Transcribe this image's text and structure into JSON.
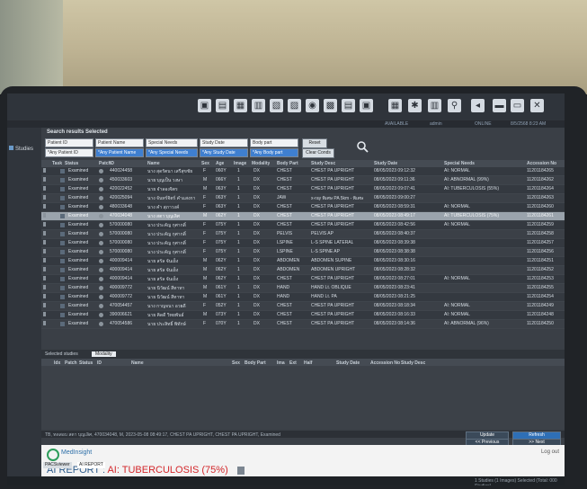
{
  "app": {
    "window_user": "AVAILABLE",
    "user": "admin",
    "status": "ONLINE",
    "clock": "8/5/2568 8:23 AM"
  },
  "sidebar": {
    "items": [
      {
        "label": "Studies"
      }
    ]
  },
  "search": {
    "title": "Search results  Selected",
    "filters_row1": [
      "Patient ID",
      "Patient Name",
      "Special Needs",
      "Study Date",
      "Body part"
    ],
    "filters_row2": [
      "*Any Patient ID",
      "*Any Patient Name",
      "*Any Special Needs",
      "*Any Study Date",
      "*Any Body part"
    ],
    "reset_label": "Reset",
    "clear_label": "Clear Conds"
  },
  "grid": {
    "headers": [
      "Task",
      "Status",
      "Patch",
      "ID",
      "Name",
      "Sex",
      "Age",
      "Image",
      "Modality",
      "Body Part",
      "Study Desc",
      "Study Date",
      "Special Needs",
      "Accession No"
    ],
    "rows": [
      {
        "status": "Examined",
        "id": "440024458",
        "name": "นาง สุดรัตนา เสรีสุขชัย",
        "sex": "F",
        "age": "060Y",
        "image": "1",
        "modality": "DX",
        "body": "CHEST",
        "desc": "CHEST PA UPRIGHT",
        "date": "08/05/2023 09:12:32",
        "needs": "AI: NORMAL",
        "acc": "11201184265"
      },
      {
        "status": "Examined",
        "id": "450033603",
        "name": "นาย บุญเป็น วงษา",
        "sex": "M",
        "age": "066Y",
        "image": "1",
        "modality": "DX",
        "body": "CHEST",
        "desc": "CHEST PA UPRIGHT",
        "date": "08/05/2023 09:11:36",
        "needs": "AI: ABNORMAL (99%)",
        "acc": "11201184262"
      },
      {
        "status": "Examined",
        "id": "420022452",
        "name": "นาย จำลองจิตร",
        "sex": "M",
        "age": "063Y",
        "image": "1",
        "modality": "DX",
        "body": "CHEST",
        "desc": "CHEST PA UPRIGHT",
        "date": "08/05/2023 09:07:41",
        "needs": "AI: TUBERCULOSIS (55%)",
        "acc": "11201184264"
      },
      {
        "status": "Examined",
        "id": "420025094",
        "name": "นาง จันทร์จิตร์ คำแสงกา",
        "sex": "F",
        "age": "063Y",
        "image": "1",
        "modality": "DX",
        "body": "JAW",
        "desc": "x-ray พิเศษ PA 5km - พิเศษ",
        "date": "08/05/2023 09:00:27",
        "needs": "",
        "acc": "11201184263"
      },
      {
        "status": "Examined",
        "id": "480033648",
        "name": "นาง คำ สุภาวงค์",
        "sex": "F",
        "age": "063Y",
        "image": "1",
        "modality": "DX",
        "body": "CHEST",
        "desc": "CHEST PA UPRIGHT",
        "date": "08/05/2023 08:59:31",
        "needs": "AI: NORMAL",
        "acc": "11201184260"
      },
      {
        "status": "Examined",
        "id": "470034048",
        "name": "นาง สตา บุญเลิศ",
        "sex": "M",
        "age": "062Y",
        "image": "1",
        "modality": "DX",
        "body": "CHEST",
        "desc": "CHEST PA UPRIGHT",
        "date": "08/05/2023 08:49:17",
        "needs": "AI: TUBERCULOSIS (75%)",
        "acc": "11201184261",
        "selected": true
      },
      {
        "status": "Examined",
        "id": "570000080",
        "name": "นาง ประคัญ กุศากดิ์",
        "sex": "F",
        "age": "075Y",
        "image": "1",
        "modality": "DX",
        "body": "CHEST",
        "desc": "CHEST PA UPRIGHT",
        "date": "08/05/2023 08:42:56",
        "needs": "AI: NORMAL",
        "acc": "11201184259"
      },
      {
        "status": "Examined",
        "id": "570000080",
        "name": "นาง ประคัญ กุศากดิ์",
        "sex": "F",
        "age": "075Y",
        "image": "1",
        "modality": "DX",
        "body": "PELVIS",
        "desc": "PELVIS AP",
        "date": "08/05/2023 08:40:37",
        "needs": "",
        "acc": "11201184258"
      },
      {
        "status": "Examined",
        "id": "570000080",
        "name": "นาง ประคัญ กุศากดิ์",
        "sex": "F",
        "age": "075Y",
        "image": "1",
        "modality": "DX",
        "body": "LSPINE",
        "desc": "L-S SPINE LATERAL",
        "date": "08/05/2023 08:39:38",
        "needs": "",
        "acc": "11201184257"
      },
      {
        "status": "Examined",
        "id": "570000080",
        "name": "นาง ประคัญ กุศากดิ์",
        "sex": "F",
        "age": "075Y",
        "image": "1",
        "modality": "DX",
        "body": "LSPINE",
        "desc": "L-S SPINE AP",
        "date": "08/05/2023 08:38:38",
        "needs": "",
        "acc": "11201184256"
      },
      {
        "status": "Examined",
        "id": "400009414",
        "name": "นาย สรัล จันเย็ง",
        "sex": "M",
        "age": "062Y",
        "image": "1",
        "modality": "DX",
        "body": "ABDOMEN",
        "desc": "ABDOMEN SUPINE",
        "date": "08/05/2023 08:30:16",
        "needs": "",
        "acc": "11201184251"
      },
      {
        "status": "Examined",
        "id": "400009414",
        "name": "นาย สรัล จันเย็ง",
        "sex": "M",
        "age": "062Y",
        "image": "1",
        "modality": "DX",
        "body": "ABDOMEN",
        "desc": "ABDOMEN UPRIGHT",
        "date": "08/05/2023 08:28:32",
        "needs": "",
        "acc": "11201184252"
      },
      {
        "status": "Examined",
        "id": "400009414",
        "name": "นาย สรัล จันเย็ง",
        "sex": "M",
        "age": "062Y",
        "image": "1",
        "modality": "DX",
        "body": "CHEST",
        "desc": "CHEST PA UPRIGHT",
        "date": "08/05/2023 08:27:01",
        "needs": "AI: NORMAL",
        "acc": "11201184253"
      },
      {
        "status": "Examined",
        "id": "400009772",
        "name": "นาย นิวัฒน์ สีทาทา",
        "sex": "M",
        "age": "061Y",
        "image": "1",
        "modality": "DX",
        "body": "HAND",
        "desc": "HAND Lt. OBLIQUE",
        "date": "08/05/2023 08:23:41",
        "needs": "",
        "acc": "11201184255"
      },
      {
        "status": "Examined",
        "id": "400009772",
        "name": "นาย นิวัฒน์ สีทาทา",
        "sex": "M",
        "age": "061Y",
        "image": "1",
        "modality": "DX",
        "body": "HAND",
        "desc": "HAND Lt. PA",
        "date": "08/05/2023 08:21:25",
        "needs": "",
        "acc": "11201184254"
      },
      {
        "status": "Examined",
        "id": "470054457",
        "name": "นาง กาญจนา อวยดี",
        "sex": "F",
        "age": "052Y",
        "image": "1",
        "modality": "DX",
        "body": "CHEST",
        "desc": "CHEST PA UPRIGHT",
        "date": "08/05/2023 08:18:34",
        "needs": "AI: NORMAL",
        "acc": "11201184249"
      },
      {
        "status": "Examined",
        "id": "390006621",
        "name": "นาย คิดดี วิทยพันธ์",
        "sex": "M",
        "age": "073Y",
        "image": "1",
        "modality": "DX",
        "body": "CHEST",
        "desc": "CHEST PA UPRIGHT",
        "date": "08/05/2023 08:16:33",
        "needs": "AI: NORMAL",
        "acc": "11201184248"
      },
      {
        "status": "Examined",
        "id": "470054586",
        "name": "นาย ประสิทธิ์ พิทักษ์",
        "sex": "F",
        "age": "070Y",
        "image": "1",
        "modality": "DX",
        "body": "CHEST",
        "desc": "CHEST PA UPRIGHT",
        "date": "08/05/2023 08:14:36",
        "needs": "AI: ABNORMAL (96%)",
        "acc": "11201184250"
      }
    ]
  },
  "selected_section": {
    "title": "Selected studies",
    "modality_label": "Modality",
    "headers": [
      "Idx",
      "Patch",
      "Status",
      "ID",
      "Name",
      "Sex",
      "Body Part",
      "Ima",
      "Ext",
      "Half",
      "Study Date",
      "Accession No",
      "Study Desc"
    ]
  },
  "info": {
    "text": "TB, ทดสอบ สตา บุญเลิศ, 470034048, M, 2023-05-08 08:49:17, CHEST PA UPRIGHT, CHEST PA UPRIGHT, Examined",
    "update_label": "Update",
    "refresh_label": "Refresh",
    "prev_label": "<< Previous",
    "next_label": ">> Next"
  },
  "ai_report": {
    "brand": "MedInsight",
    "logout": "Log out",
    "title": "AI REPORT : ",
    "result": "AI: TUBERCULOSIS (75%)",
    "result_color": "#d3272b"
  },
  "bottom_tabs": [
    "PACSviewer",
    "AI REPORT"
  ],
  "taskbar": {
    "status": "1 Studies (1 Images) Selected (Total: 000 Studies)"
  }
}
